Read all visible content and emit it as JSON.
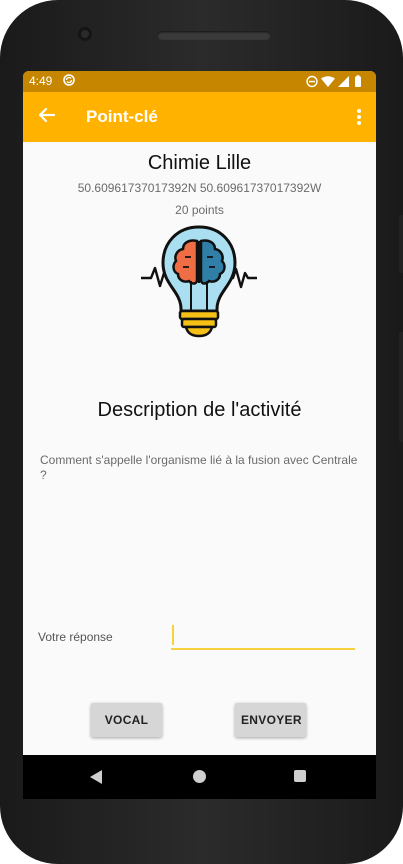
{
  "status_bar": {
    "time": "4:49"
  },
  "app_bar": {
    "title": "Point-clé"
  },
  "place": {
    "name": "Chimie Lille",
    "coordinates": "50.60961737017392N 50.60961737017392W",
    "points": "20 points"
  },
  "activity": {
    "title": "Description de l'activité",
    "question": "Comment s'appelle l'organisme lié à la fusion avec Centrale ?"
  },
  "answer": {
    "label": "Votre réponse",
    "value": ""
  },
  "buttons": {
    "vocal": "VOCAL",
    "send": "ENVOYER"
  },
  "colors": {
    "status_bar": "#c68600",
    "app_bar": "#ffb300",
    "input_underline": "#f7d33b",
    "button_bg": "#d6d6d6"
  },
  "icons": [
    "back-arrow-icon",
    "overflow-menu-icon",
    "lightbulb-brain-icon",
    "sync-icon",
    "dnd-icon",
    "wifi-icon",
    "signal-icon",
    "battery-icon"
  ]
}
